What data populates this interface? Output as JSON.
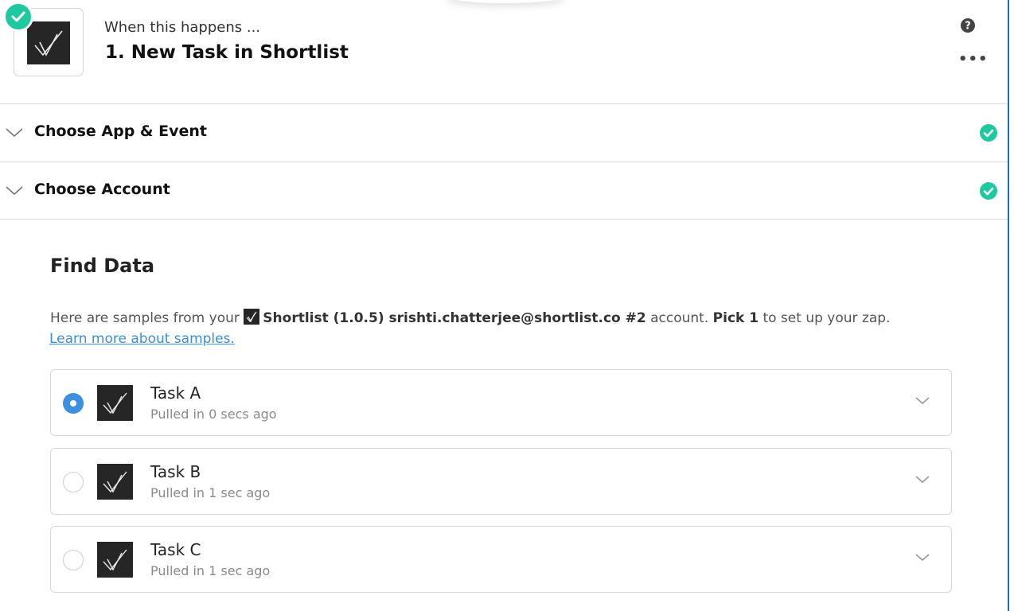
{
  "header": {
    "subtitle": "When this happens ...",
    "title": "1. New Task in Shortlist"
  },
  "sections": [
    {
      "label": "Choose App & Event",
      "status": "complete"
    },
    {
      "label": "Choose Account",
      "status": "complete"
    }
  ],
  "find_data": {
    "title": "Find Data",
    "desc_prefix": "Here are samples from your",
    "account_name": "Shortlist (1.0.5) srishti.chatterjee@shortlist.co #2",
    "desc_mid": "account.",
    "pick": "Pick 1",
    "desc_suffix": "to set up your zap.",
    "learn_link": "Learn more about samples."
  },
  "samples": [
    {
      "name": "Task A",
      "meta": "Pulled in 0 secs ago",
      "selected": true
    },
    {
      "name": "Task B",
      "meta": "Pulled in 1 sec ago",
      "selected": false
    },
    {
      "name": "Task C",
      "meta": "Pulled in 1 sec ago",
      "selected": false
    }
  ],
  "colors": {
    "success": "#1ec9a0",
    "accent": "#3d8fe0",
    "link": "#3b8fd9"
  },
  "icons": {
    "app_logo": "shortlist-logo-icon",
    "status": "check-circle-icon",
    "help": "question-circle-icon",
    "more": "ellipsis-icon",
    "expand": "chevron-down-icon"
  }
}
